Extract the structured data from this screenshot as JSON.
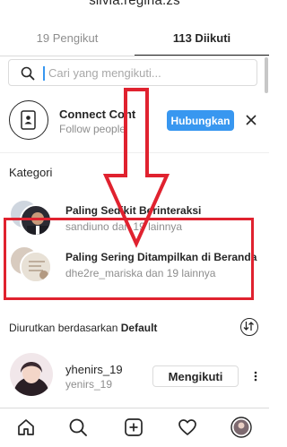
{
  "header": {
    "username": "silvia.regina.zs"
  },
  "tabs": [
    {
      "label": "19 Pengikut"
    },
    {
      "label": "113 Diikuti"
    }
  ],
  "search": {
    "placeholder": "Cari yang mengikuti..."
  },
  "connect": {
    "title": "Connect Cont",
    "subtitle": "Follow people",
    "button_label": "Hubungkan"
  },
  "categories": {
    "heading": "Kategori",
    "items": [
      {
        "title": "Paling Sedikit Berinteraksi",
        "subtitle": "sandiuno dan 19 lainnya"
      },
      {
        "title": "Paling Sering Ditampilkan di Beranda",
        "subtitle": "dhe2re_mariska dan 19 lainnya"
      }
    ]
  },
  "sort": {
    "prefix": "Diurutkan berdasarkan ",
    "value": "Default"
  },
  "followers": [
    {
      "name": "yhenirs_19",
      "handle": "yenirs_19",
      "button_label": "Mengikuti"
    }
  ],
  "colors": {
    "accent": "#3897f0",
    "highlight_red": "#e0222f"
  },
  "icons": {
    "search": "search-icon",
    "contacts": "contact-book-icon",
    "close": "close-icon",
    "sort": "sort-icon",
    "more": "more-icon",
    "nav": [
      "home-icon",
      "search-icon",
      "add-post-icon",
      "heart-icon",
      "profile-icon"
    ]
  }
}
